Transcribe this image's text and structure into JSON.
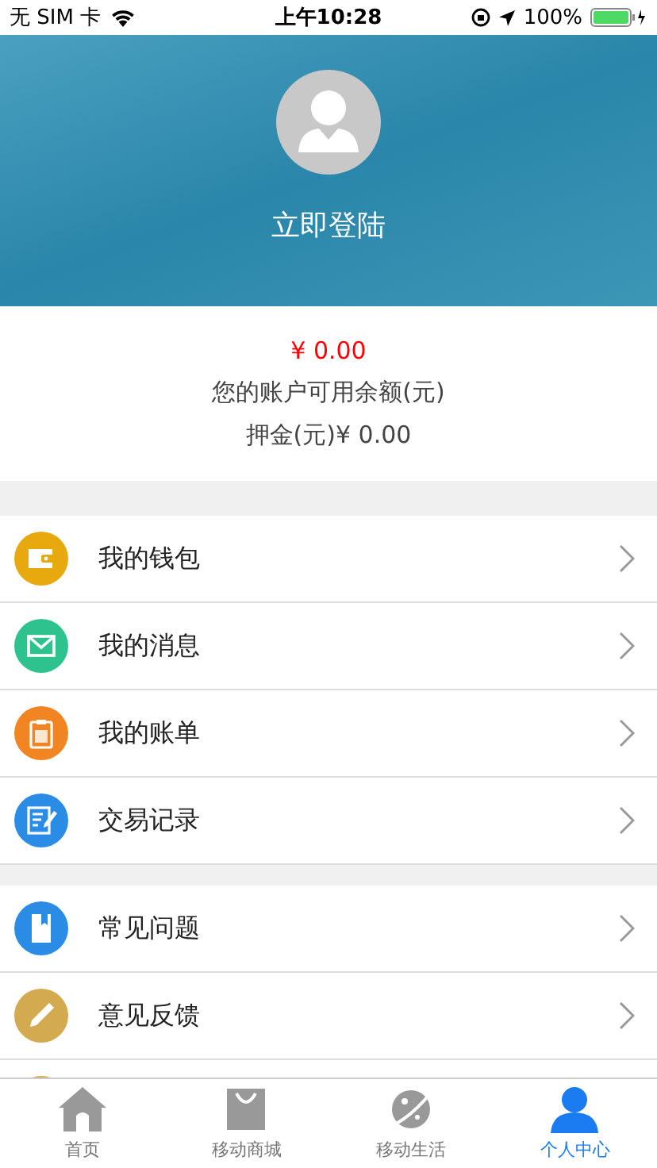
{
  "status_bar": {
    "carrier": "无 SIM 卡",
    "time": "上午10:28",
    "battery": "100%"
  },
  "profile": {
    "login": "立即登陆"
  },
  "balance": {
    "amount": "¥ 0.00",
    "label": "您的账户可用余额(元)",
    "deposit": "押金(元)¥ 0.00"
  },
  "groups": [
    {
      "items": [
        {
          "label": "我的钱包",
          "kind": "wallet",
          "color": "#e8a90f"
        },
        {
          "label": "我的消息",
          "kind": "mail",
          "color": "#2ec28f"
        },
        {
          "label": "我的账单",
          "kind": "clipboard",
          "color": "#f08522"
        },
        {
          "label": "交易记录",
          "kind": "note",
          "color": "#2b8ce6"
        }
      ]
    },
    {
      "items": [
        {
          "label": "常见问题",
          "kind": "book",
          "color": "#2b8ce6"
        },
        {
          "label": "意见反馈",
          "kind": "pencil",
          "color": "#d4aa50"
        }
      ]
    }
  ],
  "tabs": [
    {
      "label": "首页",
      "kind": "home",
      "selected": false
    },
    {
      "label": "移动商城",
      "kind": "bag",
      "selected": false
    },
    {
      "label": "移动生活",
      "kind": "planet",
      "selected": false
    },
    {
      "label": "个人中心",
      "kind": "person",
      "selected": true
    }
  ]
}
